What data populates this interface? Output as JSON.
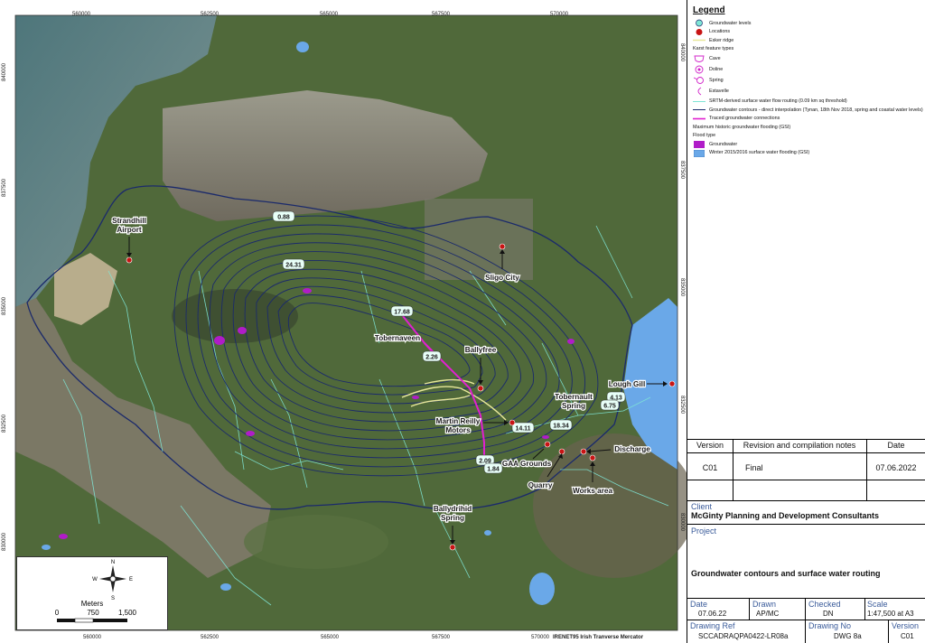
{
  "map": {
    "easting_top": [
      "560000",
      "562500",
      "565000",
      "567500",
      "570000"
    ],
    "easting_bottom": [
      "560000",
      "562500",
      "565000",
      "567500",
      "570000"
    ],
    "northing_left": [
      "840000",
      "837500",
      "835000",
      "832500",
      "830000"
    ],
    "northing_right": [
      "840000",
      "837500",
      "835000",
      "832500",
      "830000"
    ],
    "crs": "IRENET95 Irish Tranverse Mercator",
    "locations": [
      {
        "label": "Strandhill Airport"
      },
      {
        "label": "Sligo City"
      },
      {
        "label": "Tobernaveen"
      },
      {
        "label": "Ballyfree"
      },
      {
        "label": "Lough Gill"
      },
      {
        "label": "Tobernault Spring"
      },
      {
        "label": "Martin Reilly Motors"
      },
      {
        "label": "Discharge"
      },
      {
        "label": "GAA Grounds"
      },
      {
        "label": "Quarry"
      },
      {
        "label": "Works area"
      },
      {
        "label": "Ballydrihid Spring"
      }
    ],
    "contour_values": [
      {
        "v": "0.88"
      },
      {
        "v": "24.31"
      },
      {
        "v": "17.68"
      },
      {
        "v": "2.26"
      },
      {
        "v": "4.13"
      },
      {
        "v": "6.75"
      },
      {
        "v": "14.11"
      },
      {
        "v": "18.34"
      },
      {
        "v": "2.09"
      },
      {
        "v": "1.84"
      }
    ]
  },
  "scalebar": {
    "north": "N",
    "south": "S",
    "east": "E",
    "west": "W",
    "units": "Meters",
    "ticks": [
      "0",
      "750",
      "1,500"
    ]
  },
  "legend": {
    "title": "Legend",
    "items": [
      "Groundwater levels",
      "Locations",
      "Esker ridge",
      "Karst feature types",
      "Cave",
      "Doline",
      "Spring",
      "Estavelle",
      "SRTM-derived surface water flow routing (0.09 km sq threshold)",
      "Groundwater contours - direct interpolation (Tynan, 18th Nov 2018, spring and coastal water levels)",
      "Traced groundwater connections",
      "Maximum historic groundwater flooding (GSI)",
      "Flood type",
      "Groundwater",
      "Winter 2015/2016 surface water flooding (GSI)"
    ]
  },
  "revision": {
    "headers": {
      "version": "Version",
      "notes": "Revision and compilation notes",
      "date": "Date"
    },
    "row": {
      "version": "C01",
      "notes": "Final",
      "date": "07.06.2022"
    }
  },
  "client": {
    "label": "Client",
    "value": "McGinty Planning and Development Consultants"
  },
  "project": {
    "label": "Project",
    "value": "Groundwater contours and surface water routing"
  },
  "titleblock": {
    "date_label": "Date",
    "date": "07.06.22",
    "drawn_label": "Drawn",
    "drawn": "AP/MC",
    "checked_label": "Checked",
    "checked": "DN",
    "scale_label": "Scale",
    "scale": "1:47,500 at A3",
    "ref_label": "Drawing Ref",
    "ref": "SCCADRAQPA0422-LR08a",
    "no_label": "Drawing No",
    "no": "DWG 8a",
    "version_label": "Version",
    "version": "C01"
  },
  "colors": {
    "sea": "#5b7d84",
    "land": "#4f6a3a",
    "contour": "#1b2a6b",
    "stream": "#7fe6d6",
    "traced": "#e020d0",
    "esker": "#e7e79a",
    "groundwater_flood": "#b01cc8",
    "surface_flood": "#6aa8e8",
    "location": "#c81414"
  }
}
